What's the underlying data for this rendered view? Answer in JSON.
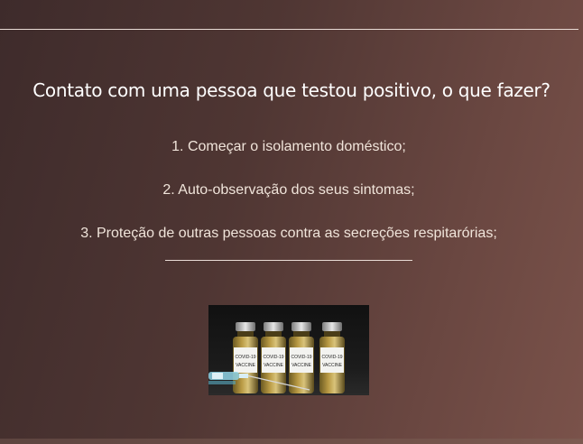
{
  "page": {
    "title": "Contato com uma pessoa que testou positivo, o que fazer?"
  },
  "steps": [
    {
      "label": "1. Começar o isolamento doméstico;"
    },
    {
      "label": "2. Auto-observação dos seus sintomas;"
    },
    {
      "label": "3. Proteção de outras pessoas contra as secreções respitarórias;"
    }
  ],
  "image": {
    "vial_labels": [
      {
        "line1": "COVID-19",
        "line2": "VACCINE"
      },
      {
        "line1": "COVID-19",
        "line2": "VACCINE"
      },
      {
        "line1": "COVID-19",
        "line2": "VACCINE"
      },
      {
        "line1": "COVID-19",
        "line2": "VACCINE"
      }
    ]
  },
  "colors": {
    "background_start": "#3e2b2b",
    "background_end": "#7a524a",
    "text": "#f0e4da",
    "rule": "#e9dcd6"
  }
}
